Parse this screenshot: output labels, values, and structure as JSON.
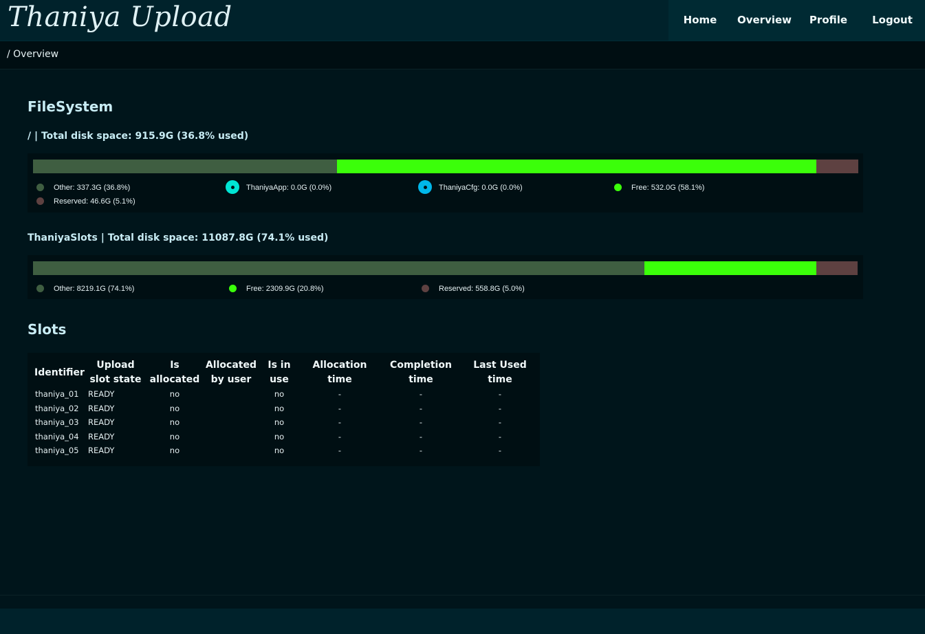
{
  "app": {
    "title": "Thaniya Upload"
  },
  "nav": {
    "home": "Home",
    "overview": "Overview",
    "profile": "Profile",
    "logout": "Logout"
  },
  "breadcrumb": "/ Overview",
  "filesystem": {
    "heading": "FileSystem",
    "disks": [
      {
        "title": "/  |  Total disk space: 915.9G (36.8% used)",
        "segments": [
          {
            "label": "Other: 337.3G (36.8%)",
            "fraction": 0.368,
            "color": "#3f5e41"
          },
          {
            "label": "ThaniyaApp: 0.0G (0.0%)",
            "fraction": 0.0,
            "color": "#00e5d4"
          },
          {
            "label": "ThaniyaCfg: 0.0G (0.0%)",
            "fraction": 0.0,
            "color": "#00b7ea"
          },
          {
            "label": "Free: 532.0G (58.1%)",
            "fraction": 0.581,
            "color": "#3bff0a"
          },
          {
            "label": "Reserved: 46.6G (5.1%)",
            "fraction": 0.051,
            "color": "#5e4141"
          }
        ]
      },
      {
        "title": "ThaniyaSlots  |  Total disk space: 11087.8G (74.1% used)",
        "segments": [
          {
            "label": "Other: 8219.1G (74.1%)",
            "fraction": 0.741,
            "color": "#3f5e41"
          },
          {
            "label": "Free: 2309.9G (20.8%)",
            "fraction": 0.208,
            "color": "#3bff0a"
          },
          {
            "label": "Reserved: 558.8G (5.0%)",
            "fraction": 0.05,
            "color": "#5e4141"
          }
        ]
      }
    ]
  },
  "slots": {
    "heading": "Slots",
    "columns": [
      "Identifier",
      "Upload slot state",
      "Is allocated",
      "Allocated by user",
      "Is in use",
      "Allocation time",
      "Completion time",
      "Last Used time"
    ],
    "rows": [
      [
        "thaniya_01",
        "READY",
        "no",
        "",
        "no",
        "-",
        "-",
        "-"
      ],
      [
        "thaniya_02",
        "READY",
        "no",
        "",
        "no",
        "-",
        "-",
        "-"
      ],
      [
        "thaniya_03",
        "READY",
        "no",
        "",
        "no",
        "-",
        "-",
        "-"
      ],
      [
        "thaniya_04",
        "READY",
        "no",
        "",
        "no",
        "-",
        "-",
        "-"
      ],
      [
        "thaniya_05",
        "READY",
        "no",
        "",
        "no",
        "-",
        "-",
        "-"
      ]
    ]
  }
}
